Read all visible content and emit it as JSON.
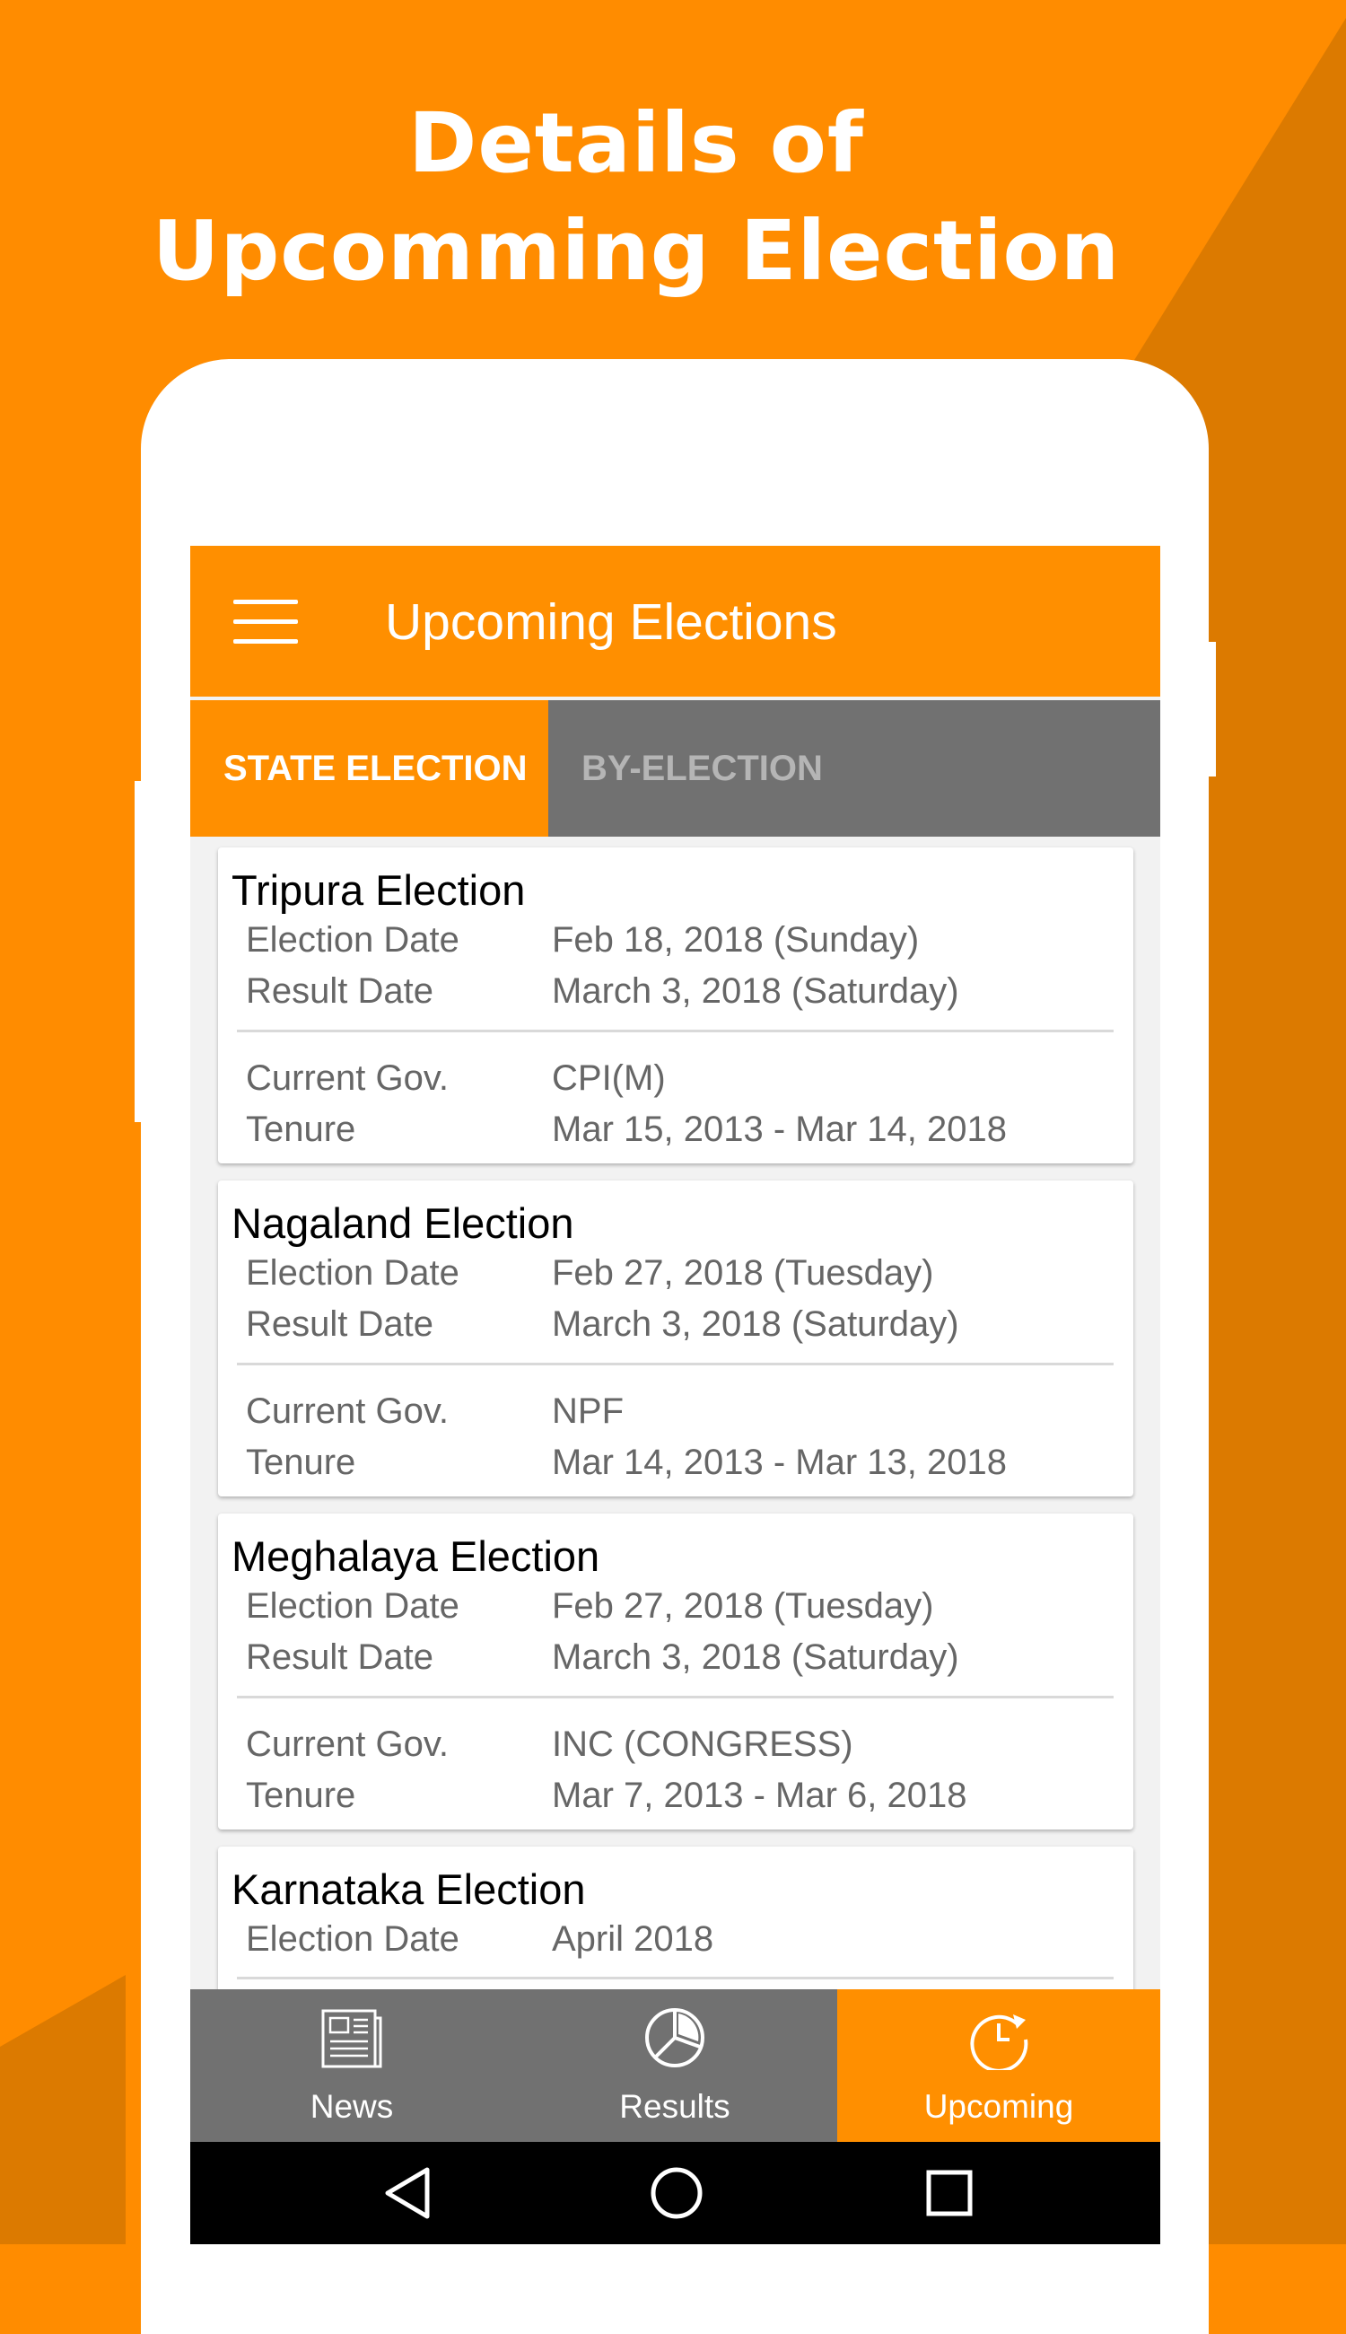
{
  "colors": {
    "brand_orange": "#FF8C00",
    "accent_orange": "#FF8F00",
    "stripe_orange": "#DC7A00",
    "tab_gray": "#717171",
    "text_gray": "#666666"
  },
  "promo": {
    "line1": "Details of",
    "line2": "Upcomming Election"
  },
  "app_bar": {
    "menu_icon": "hamburger-icon",
    "title": "Upcoming Elections"
  },
  "tabs": [
    {
      "label": "STATE ELECTION",
      "selected": true
    },
    {
      "label": "BY-ELECTION",
      "selected": false
    }
  ],
  "elections": [
    {
      "title": "Tripura Election",
      "election_date_label": "Election Date",
      "election_date": "Feb 18, 2018 (Sunday)",
      "result_date_label": "Result Date",
      "result_date": "March 3, 2018 (Saturday)",
      "current_gov_label": "Current Gov.",
      "current_gov": "CPI(M)",
      "tenure_label": "Tenure",
      "tenure": "Mar 15, 2013 - Mar 14, 2018"
    },
    {
      "title": "Nagaland Election",
      "election_date_label": "Election Date",
      "election_date": "Feb 27, 2018 (Tuesday)",
      "result_date_label": "Result Date",
      "result_date": "March 3, 2018 (Saturday)",
      "current_gov_label": "Current Gov.",
      "current_gov": "NPF",
      "tenure_label": "Tenure",
      "tenure": "Mar 14, 2013 - Mar 13, 2018"
    },
    {
      "title": "Meghalaya Election",
      "election_date_label": "Election Date",
      "election_date": "Feb 27, 2018 (Tuesday)",
      "result_date_label": "Result Date",
      "result_date": "March 3, 2018 (Saturday)",
      "current_gov_label": "Current Gov.",
      "current_gov": "INC (CONGRESS)",
      "tenure_label": "Tenure",
      "tenure": "Mar 7, 2013 - Mar 6, 2018"
    },
    {
      "title": "Karnataka Election",
      "election_date_label": "Election Date",
      "election_date": "April 2018"
    }
  ],
  "bottom_nav": [
    {
      "label": "News",
      "icon": "newspaper-icon",
      "selected": false
    },
    {
      "label": "Results",
      "icon": "pie-chart-icon",
      "selected": false
    },
    {
      "label": "Upcoming",
      "icon": "clock-refresh-icon",
      "selected": true
    }
  ],
  "system_nav": {
    "back_icon": "back-triangle-icon",
    "home_icon": "home-circle-icon",
    "recents_icon": "recents-square-icon"
  }
}
